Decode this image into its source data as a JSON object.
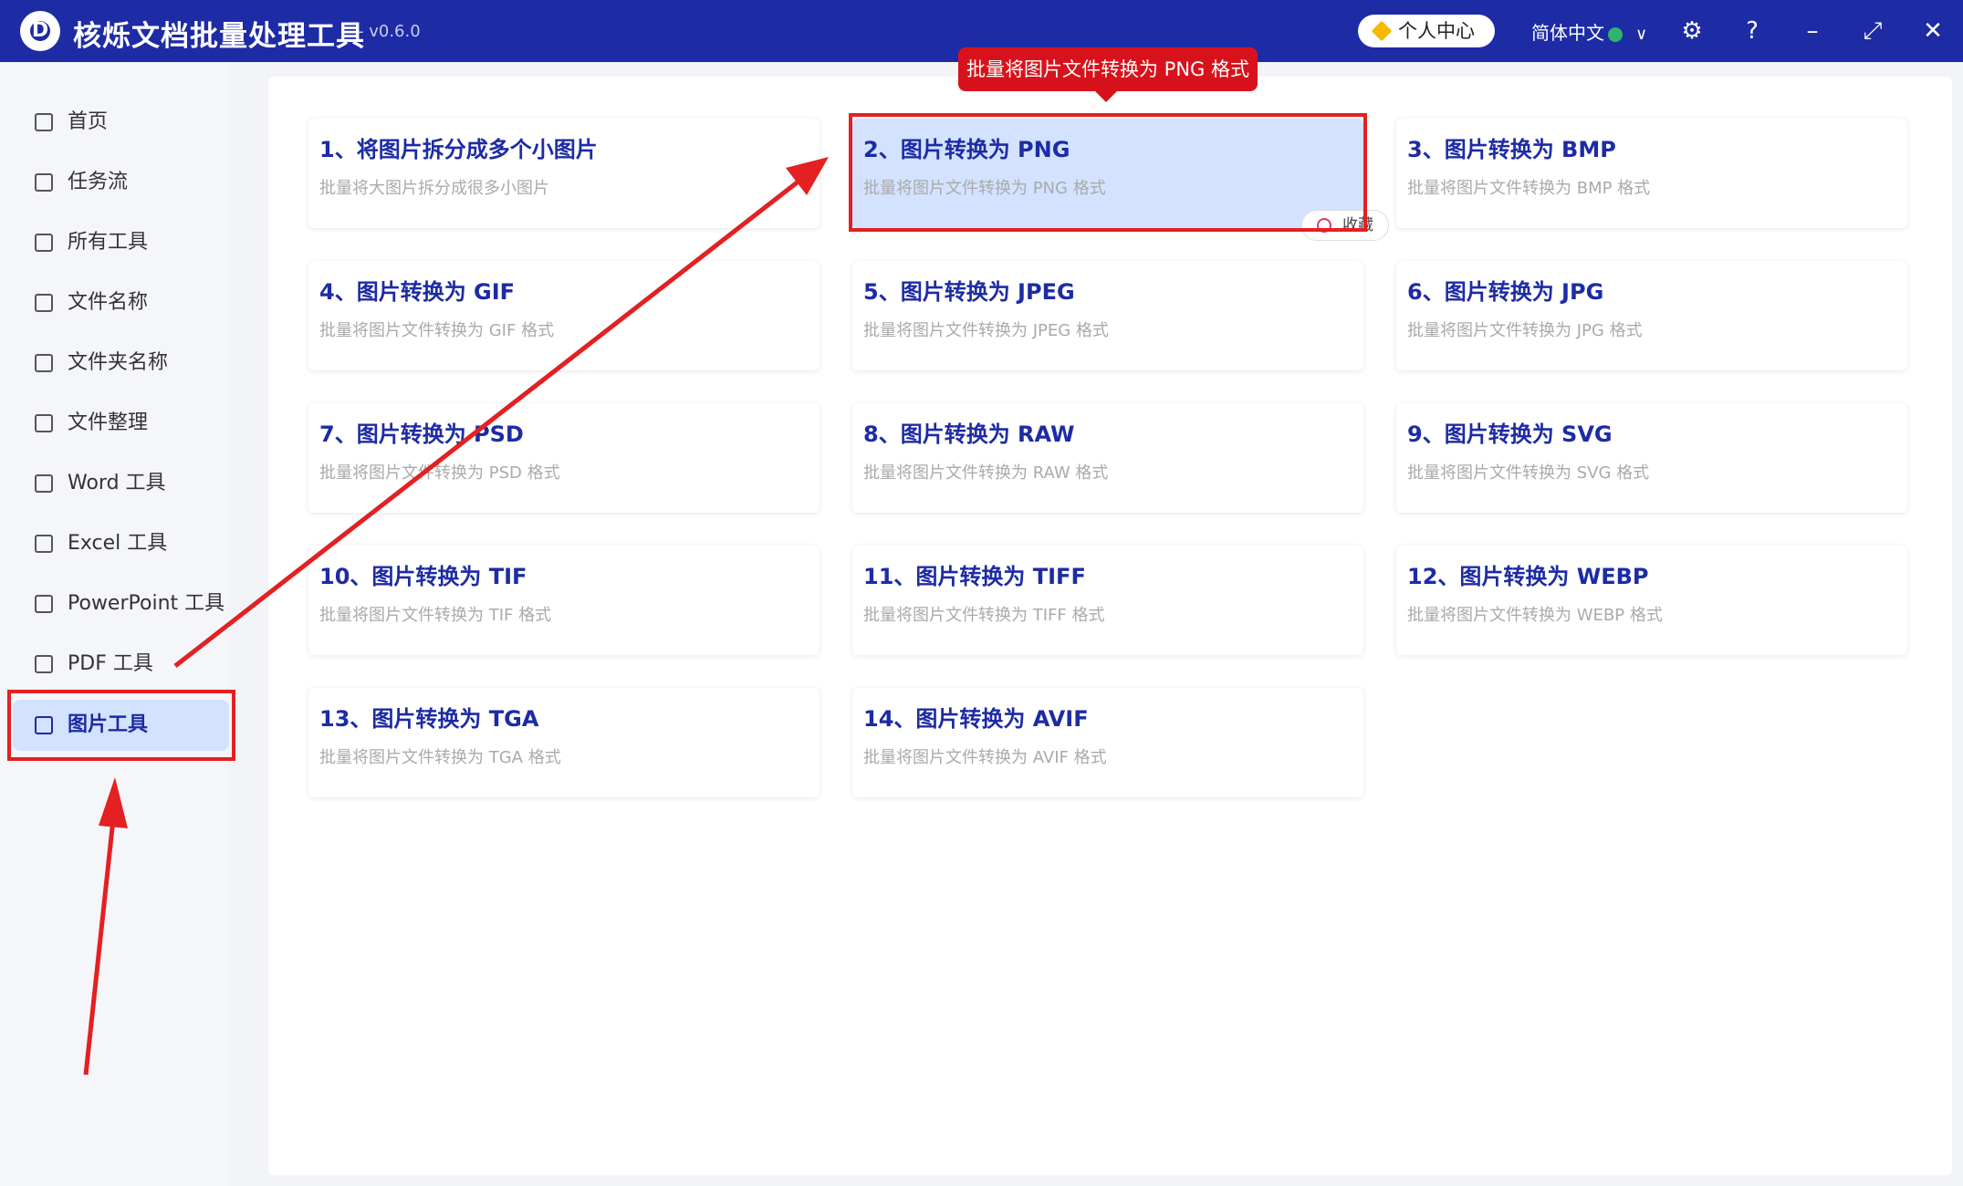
{
  "titlebar": {
    "logo_letter": "D",
    "title": "核烁文档批量处理工具",
    "version": "- v0.6.0",
    "user_center": "个人中心",
    "language": "简体中文",
    "icons": [
      "settings-icon",
      "help-icon",
      "minimize-icon",
      "maximize-icon",
      "close-icon"
    ]
  },
  "sidebar": {
    "items": [
      {
        "label": "首页",
        "icon": "home-icon"
      },
      {
        "label": "任务流",
        "icon": "workflow-icon"
      },
      {
        "label": "所有工具",
        "icon": "monitor-icon"
      },
      {
        "label": "文件名称",
        "icon": "file-name-icon"
      },
      {
        "label": "文件夹名称",
        "icon": "folder-icon"
      },
      {
        "label": "文件整理",
        "icon": "organize-icon"
      },
      {
        "label": "Word 工具",
        "icon": "word-icon"
      },
      {
        "label": "Excel 工具",
        "icon": "excel-icon"
      },
      {
        "label": "PowerPoint 工具",
        "icon": "powerpoint-icon"
      },
      {
        "label": "PDF 工具",
        "icon": "pdf-icon"
      },
      {
        "label": "图片工具",
        "icon": "image-icon",
        "active": true
      }
    ]
  },
  "tools": [
    {
      "title": "1、将图片拆分成多个小图片",
      "desc": "批量将大图片拆分成很多小图片"
    },
    {
      "title": "2、图片转换为 PNG",
      "desc": "批量将图片文件转换为 PNG 格式",
      "selected": true
    },
    {
      "title": "3、图片转换为 BMP",
      "desc": "批量将图片文件转换为 BMP 格式"
    },
    {
      "title": "4、图片转换为 GIF",
      "desc": "批量将图片文件转换为 GIF 格式"
    },
    {
      "title": "5、图片转换为 JPEG",
      "desc": "批量将图片文件转换为 JPEG 格式"
    },
    {
      "title": "6、图片转换为 JPG",
      "desc": "批量将图片文件转换为 JPG 格式"
    },
    {
      "title": "7、图片转换为 PSD",
      "desc": "批量将图片文件转换为 PSD 格式"
    },
    {
      "title": "8、图片转换为 RAW",
      "desc": "批量将图片文件转换为 RAW 格式"
    },
    {
      "title": "9、图片转换为 SVG",
      "desc": "批量将图片文件转换为 SVG 格式"
    },
    {
      "title": "10、图片转换为 TIF",
      "desc": "批量将图片文件转换为 TIF 格式"
    },
    {
      "title": "11、图片转换为 TIFF",
      "desc": "批量将图片文件转换为 TIFF 格式"
    },
    {
      "title": "12、图片转换为 WEBP",
      "desc": "批量将图片文件转换为 WEBP 格式"
    },
    {
      "title": "13、图片转换为 TGA",
      "desc": "批量将图片文件转换为 TGA 格式"
    },
    {
      "title": "14、图片转换为 AVIF",
      "desc": "批量将图片文件转换为 AVIF 格式"
    }
  ],
  "favorite_label": "收藏",
  "tooltip": "批量将图片文件转换为 PNG 格式",
  "colors": {
    "titlebar": "#1d2ba5",
    "accent": "#1d2ba5",
    "selected": "#d3e2ff",
    "annotation": "#e32022"
  }
}
